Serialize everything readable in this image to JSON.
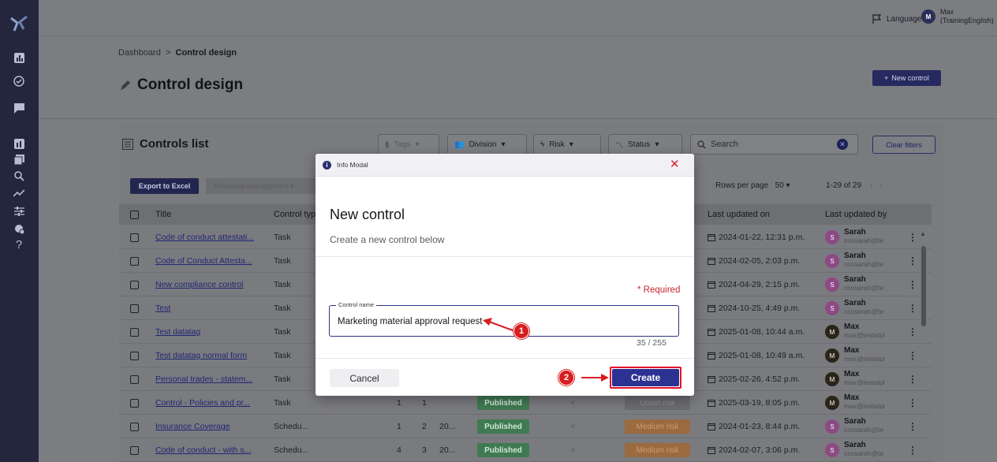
{
  "topbar": {
    "language_label": "Language",
    "user_initial": "M",
    "user_name_line1": "Max",
    "user_name_line2": "(TrainingEnglish)"
  },
  "sidebar": {
    "icons": [
      "chart-icon",
      "check-circle-icon",
      "chat-icon",
      "report-icon",
      "book-icon",
      "search-icon",
      "trend-icon",
      "sliders-icon",
      "settings-icon",
      "help-icon"
    ],
    "help_glyph": "?"
  },
  "breadcrumb": {
    "root": "Dashboard",
    "separator": ">",
    "current": "Control design"
  },
  "page": {
    "title": "Control design",
    "new_control_label": "New control"
  },
  "list": {
    "title": "Controls list",
    "filters": {
      "tags": "Tags",
      "division": "Division",
      "risk": "Risk",
      "status": "Status"
    },
    "search_placeholder": "Search",
    "clear_filters": "Clear filters",
    "export_label": "Export to Excel",
    "absence_label": "Absences management",
    "rows_per_page_label": "Rows per page",
    "rows_per_page_value": "50",
    "pagination_text": "1-29 of 29",
    "columns": {
      "title": "Title",
      "control_type": "Control typ",
      "last_updated_on": "Last updated on",
      "last_updated_by": "Last updated by"
    },
    "rows": [
      {
        "title": "Code of conduct attestati...",
        "type": "Task",
        "updated": "2024-01-22, 12:31 p.m.",
        "user_initial": "S",
        "user": "Sarah",
        "email": "ccosarah@te"
      },
      {
        "title": "Code of Conduct Attesta...",
        "type": "Task",
        "updated": "2024-02-05, 2:03 p.m.",
        "user_initial": "S",
        "user": "Sarah",
        "email": "ccosarah@te"
      },
      {
        "title": "New compliance control",
        "type": "Task",
        "updated": "2024-04-29, 2:15 p.m.",
        "user_initial": "S",
        "user": "Sarah",
        "email": "ccosarah@te"
      },
      {
        "title": "Test",
        "type": "Task",
        "updated": "2024-10-25, 4:49 p.m.",
        "user_initial": "S",
        "user": "Sarah",
        "email": "ccosarah@te"
      },
      {
        "title": "Test datatag",
        "type": "Task",
        "updated": "2025-01-08, 10:44 a.m.",
        "user_initial": "M",
        "user": "Max",
        "email": "max@testalpl"
      },
      {
        "title": "Test datatag normal form",
        "type": "Task",
        "updated": "2025-01-08, 10:49 a.m.",
        "user_initial": "M",
        "user": "Max",
        "email": "max@testalpl"
      },
      {
        "title": "Personal trades - statem...",
        "type": "Task",
        "updated": "2025-02-26, 4:52 p.m.",
        "user_initial": "M",
        "user": "Max",
        "email": "max@testalpl"
      },
      {
        "title": "Control - Policies and pr...",
        "type": "Task",
        "c1": "1",
        "c2": "1",
        "c3": "",
        "status": "Published",
        "x": "×",
        "risk": "Unset risk",
        "updated": "2025-03-19, 8:05 p.m.",
        "user_initial": "M",
        "user": "Max",
        "email": "max@testalpl"
      },
      {
        "title": "Insurance Coverage",
        "type": "Schedu...",
        "c1": "1",
        "c2": "2",
        "c3": "20...",
        "status": "Published",
        "x": "×",
        "risk": "Medium risk",
        "updated": "2024-01-23, 8:44 p.m.",
        "user_initial": "S",
        "user": "Sarah",
        "email": "ccosarah@te"
      },
      {
        "title": "Code of conduct - with s...",
        "type": "Schedu...",
        "c1": "4",
        "c2": "3",
        "c3": "20...",
        "status": "Published",
        "x": "×",
        "risk": "Medium risk",
        "updated": "2024-02-07, 3:06 p.m.",
        "user_initial": "S",
        "user": "Sarah",
        "email": "ccosarah@te"
      }
    ]
  },
  "modal": {
    "header_label": "Info Modal",
    "title": "New control",
    "subtitle": "Create a new control below",
    "required_text": "* Required",
    "field_label": "Control name",
    "field_value": "Marketing material approval request",
    "counter": "35 / 255",
    "cancel_label": "Cancel",
    "create_label": "Create"
  },
  "annotations": {
    "step1": "1",
    "step2": "2",
    "marker_color": "#d81d20"
  }
}
